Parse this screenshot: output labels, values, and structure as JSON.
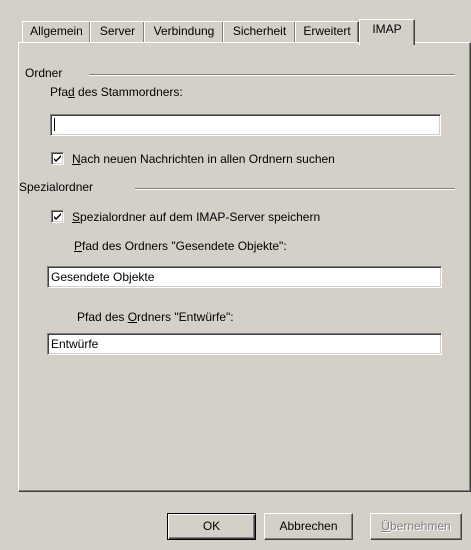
{
  "tabs": [
    {
      "label": "Allgemein"
    },
    {
      "label": "Server"
    },
    {
      "label": "Verbindung"
    },
    {
      "label": "Sicherheit"
    },
    {
      "label": "Erweitert"
    },
    {
      "label": "IMAP"
    }
  ],
  "active_tab": "IMAP",
  "ordner": {
    "group_label": "Ordner",
    "root_path_label_pre": "Pfa",
    "root_path_label_key": "d",
    "root_path_label_post": " des Stammordners:",
    "root_path_value": "",
    "check_all_checked": true,
    "check_all_key": "N",
    "check_all_rest": "ach neuen Nachrichten in allen Ordnern suchen"
  },
  "spezial": {
    "group_label": "Spezialordner",
    "store_checked": true,
    "store_key": "S",
    "store_rest": "pezialordner auf dem IMAP-Server speichern",
    "sent_label_key": "P",
    "sent_label_rest": "fad des Ordners \"Gesendete Objekte\":",
    "sent_value": "Gesendete Objekte",
    "drafts_label_pre": "Pfad des ",
    "drafts_label_key": "O",
    "drafts_label_post": "rdners \"Entwürfe\":",
    "drafts_value": "Entwürfe"
  },
  "buttons": {
    "ok": "OK",
    "cancel": "Abbrechen",
    "apply_key": "Ü",
    "apply_rest": "bernehmen"
  }
}
